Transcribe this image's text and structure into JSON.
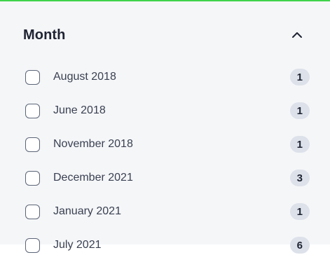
{
  "filter": {
    "title": "Month",
    "collapse_icon": "chevron-up-icon",
    "accent_color": "#3fd34b",
    "items": [
      {
        "label": "August 2018",
        "count": "1"
      },
      {
        "label": "June 2018",
        "count": "1"
      },
      {
        "label": "November 2018",
        "count": "1"
      },
      {
        "label": "December 2021",
        "count": "3"
      },
      {
        "label": "January 2021",
        "count": "1"
      },
      {
        "label": "July 2021",
        "count": "6"
      }
    ]
  }
}
